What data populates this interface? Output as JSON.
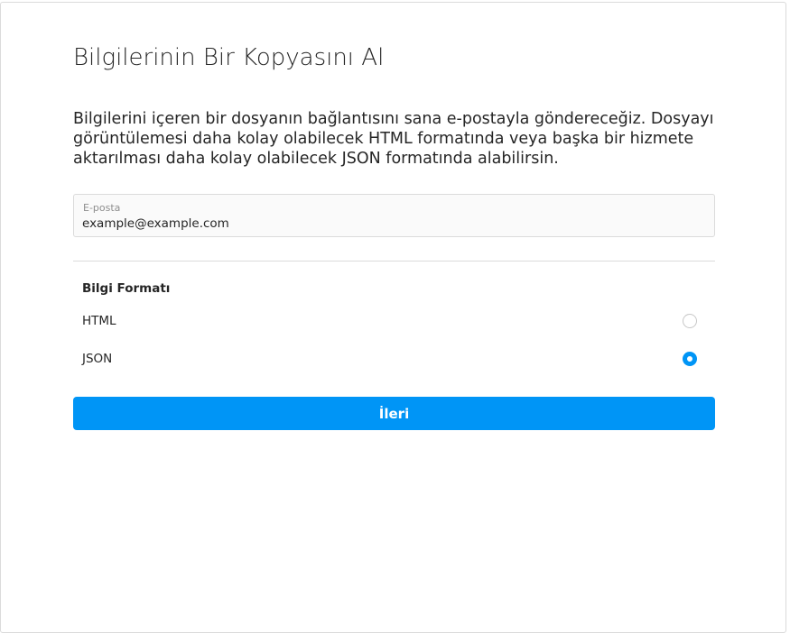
{
  "page": {
    "title": "Bilgilerinin Bir Kopyasını Al",
    "description": "Bilgilerini içeren bir dosyanın bağlantısını sana e-postayla göndereceğiz. Dosyayı görüntülemesi daha kolay olabilecek HTML formatında veya başka bir hizmete aktarılması daha kolay olabilecek JSON formatında alabilirsin."
  },
  "email": {
    "label": "E-posta",
    "value": "example@example.com"
  },
  "format": {
    "heading": "Bilgi Formatı",
    "options": [
      {
        "label": "HTML",
        "selected": false
      },
      {
        "label": "JSON",
        "selected": true
      }
    ]
  },
  "actions": {
    "next_label": "İleri"
  },
  "colors": {
    "accent": "#0095f6",
    "border": "#dbdbdb",
    "text": "#262626",
    "muted": "#8e8e8e"
  }
}
